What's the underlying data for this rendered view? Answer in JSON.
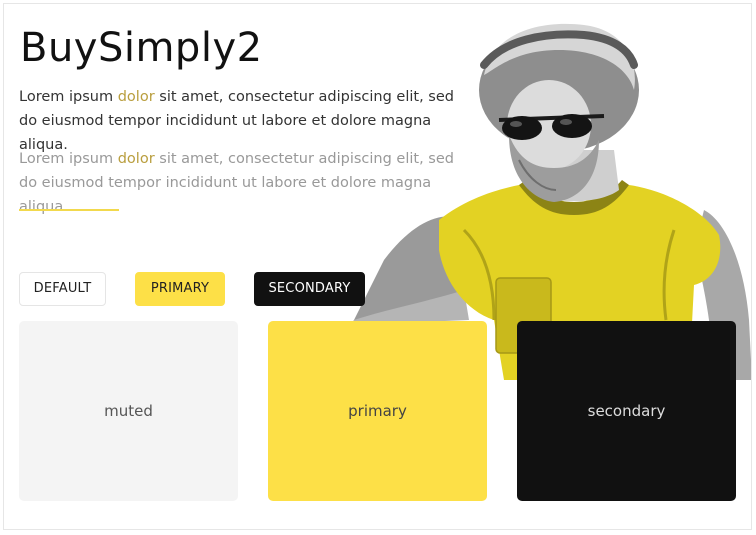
{
  "page": {
    "title": "BuySimply2",
    "para1": {
      "before": "Lorem ipsum ",
      "link": "dolor",
      "after": " sit amet, consectetur adipiscing elit, sed do eiusmod tempor incididunt ut labore et dolore magna aliqua."
    },
    "para2": {
      "before": "Lorem ipsum ",
      "link": "dolor",
      "after": " sit amet, consectetur adipiscing elit, sed do eiusmod tempor incididunt ut labore et dolore magna aliqua."
    }
  },
  "buttons": {
    "default": "DEFAULT",
    "primary": "PRIMARY",
    "secondary": "SECONDARY"
  },
  "tiles": {
    "muted": "muted",
    "primary": "primary",
    "secondary": "secondary"
  },
  "colors": {
    "accent": "#fde047",
    "link": "#b99e3e",
    "dark": "#111111",
    "muted_bg": "#f4f4f4"
  },
  "hero_image": {
    "icon": "statue-with-sunglasses-image"
  }
}
